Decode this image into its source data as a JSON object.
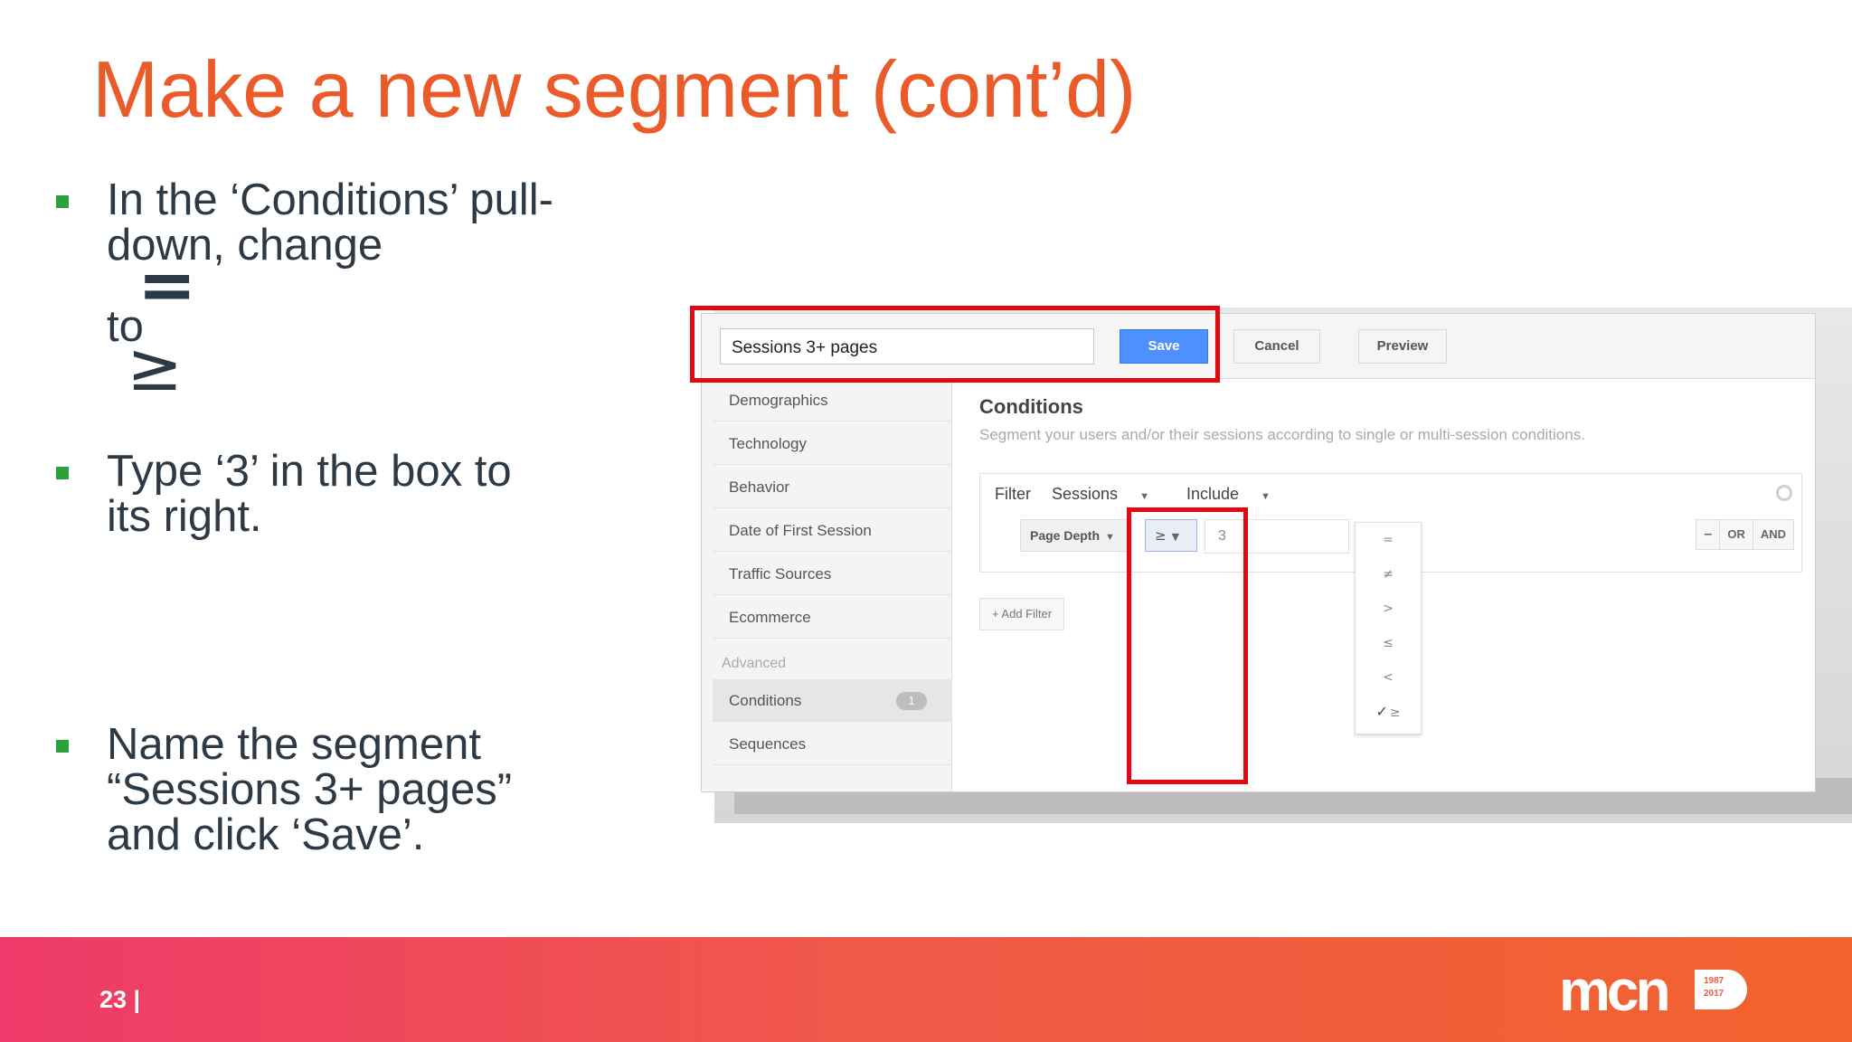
{
  "slide": {
    "title": "Make a new segment (cont’d)",
    "page_number": "23 |"
  },
  "bullets": [
    {
      "line1": "In the ‘Conditions’ pull-",
      "line2_before": "down, change",
      "symbol_from": "=",
      "line2_mid": "to",
      "symbol_to": "≥"
    },
    {
      "line1": "Type ‘3’ in the box to",
      "line2": "its right."
    },
    {
      "line1": "Name the segment",
      "line2": "“Sessions 3+ pages”",
      "line3": "and click ‘Save’."
    }
  ],
  "screenshot": {
    "segment_name": "Sessions 3+ pages",
    "save_label": "Save",
    "cancel_label": "Cancel",
    "preview_label": "Preview",
    "sidebar": {
      "items": [
        "Demographics",
        "Technology",
        "Behavior",
        "Date of First Session",
        "Traffic Sources",
        "Ecommerce"
      ],
      "advanced_label": "Advanced",
      "advanced_items": [
        "Conditions",
        "Sequences"
      ],
      "conditions_count": "1"
    },
    "panel": {
      "title": "Conditions",
      "description": "Segment your users and/or their sessions according to single or multi-session conditions.",
      "filter_label": "Filter",
      "scope": "Sessions",
      "mode": "Include",
      "dimension": "Page Depth",
      "operator": "≥",
      "value": "3",
      "logic": [
        "–",
        "OR",
        "AND"
      ],
      "add_filter": "+ Add Filter",
      "operator_options": [
        "=",
        "≠",
        ">",
        "≤",
        "<",
        "≥"
      ],
      "selected_operator": "≥"
    }
  },
  "footer": {
    "logo_text": "mcn",
    "logo_years": [
      "1987",
      "2017"
    ],
    "gradient": [
      "#ee3a6a",
      "#f2632e"
    ]
  },
  "colors": {
    "title": "#eb5b2a",
    "bullet": "#2aa13a",
    "highlight": "#e30613",
    "save_button": "#4d90fe"
  }
}
